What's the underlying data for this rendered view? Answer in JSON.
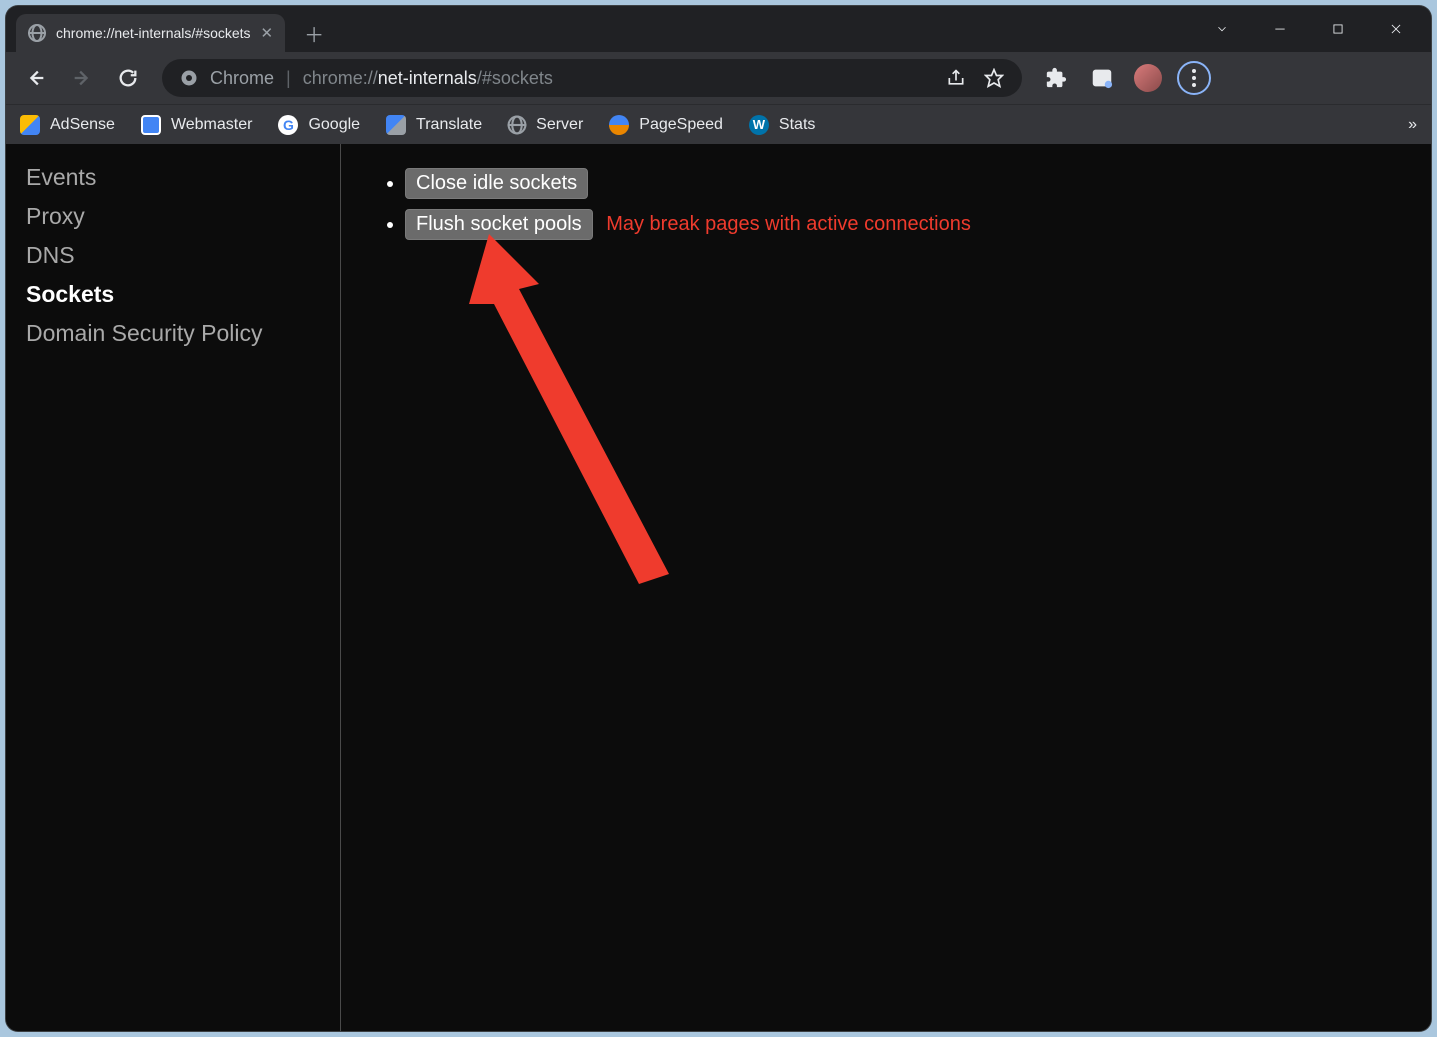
{
  "tab": {
    "title": "chrome://net-internals/#sockets"
  },
  "omnibox": {
    "label": "Chrome",
    "url_prefix": "chrome://",
    "url_main": "net-internals",
    "url_suffix": "/#sockets"
  },
  "bookmarks": [
    {
      "label": "AdSense"
    },
    {
      "label": "Webmaster"
    },
    {
      "label": "Google"
    },
    {
      "label": "Translate"
    },
    {
      "label": "Server"
    },
    {
      "label": "PageSpeed"
    },
    {
      "label": "Stats"
    }
  ],
  "sidebar": {
    "items": [
      {
        "label": "Events",
        "active": false
      },
      {
        "label": "Proxy",
        "active": false
      },
      {
        "label": "DNS",
        "active": false
      },
      {
        "label": "Sockets",
        "active": true
      },
      {
        "label": "Domain Security Policy",
        "active": false
      }
    ]
  },
  "main": {
    "close_idle_label": "Close idle sockets",
    "flush_pools_label": "Flush socket pools",
    "flush_warning": "May break pages with active connections"
  }
}
